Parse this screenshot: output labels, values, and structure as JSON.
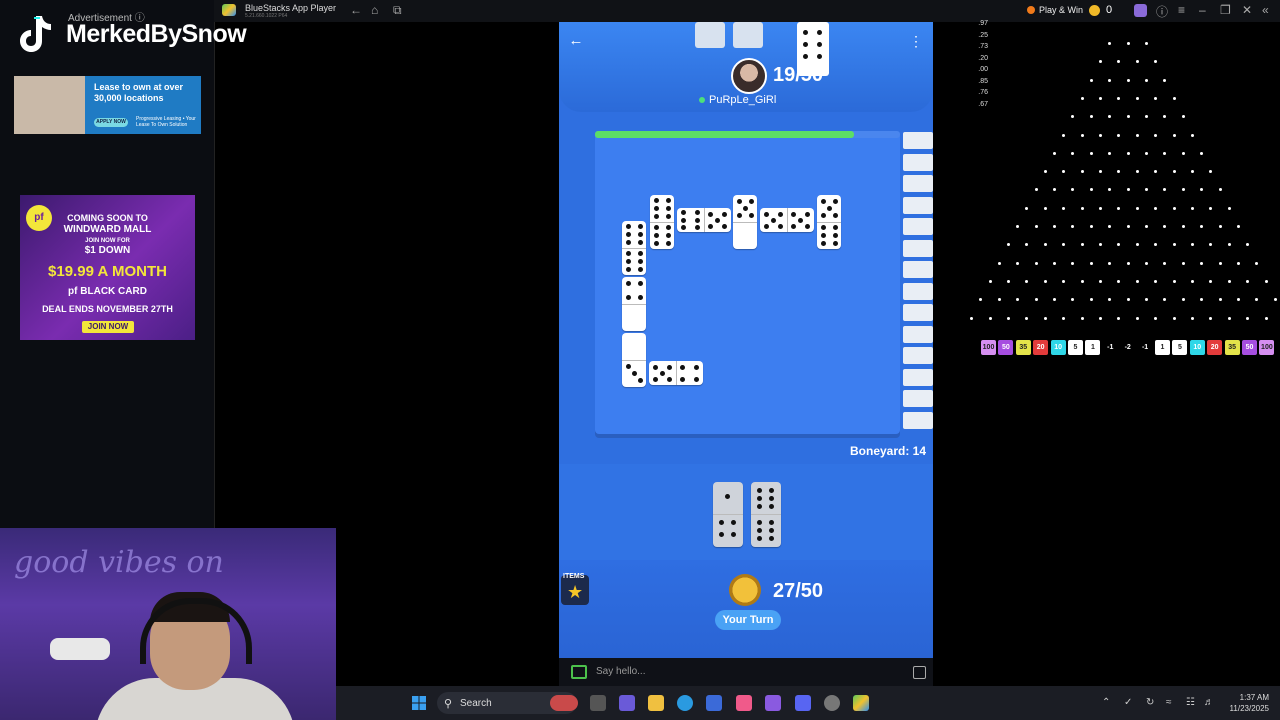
{
  "overlay": {
    "advertisement_label": "Advertisement ⓘ",
    "streamer_name": "MerkedBySnow",
    "ad1": {
      "headline": "Lease to own at over 30,000 locations",
      "button": "APPLY NOW",
      "sub": "Progressive Leasing • Your Lease To Own Solution"
    },
    "ad2": {
      "line1": "COMING SOON TO",
      "line2": "WINDWARD MALL",
      "line3": "JOIN NOW FOR",
      "line4": "$1 DOWN",
      "line5": "$19.99 A MONTH",
      "line6": "pf BLACK CARD",
      "line7": "DEAL ENDS NOVEMBER 27TH",
      "button": "JOIN NOW",
      "logo": "planet fitness"
    },
    "neon_text": "good vibes on"
  },
  "bluestacks": {
    "title": "BlueStacks App Player",
    "subtitle": "5.21.660.1022 P64",
    "play_win": "Play & Win",
    "coins": "0"
  },
  "game": {
    "opponent": {
      "name": "PuRpLe_GiRl",
      "score": "19/50"
    },
    "player": {
      "score": "27/50",
      "turn_label": "Your Turn"
    },
    "items_label": "ITEMS",
    "boneyard": "Boneyard: 14",
    "progress": 0.85,
    "chat_placeholder": "Say hello..."
  },
  "plinko": {
    "odds": [
      ".97",
      ".25",
      ".73",
      ".20",
      ".00",
      ".85",
      ".76",
      ".67"
    ],
    "buckets": [
      {
        "label": "100",
        "color": "#d58ef0"
      },
      {
        "label": "50",
        "color": "#a64ee0"
      },
      {
        "label": "35",
        "color": "#e3e34a"
      },
      {
        "label": "20",
        "color": "#e33b3b"
      },
      {
        "label": "10",
        "color": "#2fd7e8"
      },
      {
        "label": "5",
        "color": "#ffffff"
      },
      {
        "label": "1",
        "color": "#ffffff"
      },
      {
        "label": "-1",
        "color": "#000000"
      },
      {
        "label": "-2",
        "color": "#000000"
      },
      {
        "label": "-1",
        "color": "#000000"
      },
      {
        "label": "1",
        "color": "#ffffff"
      },
      {
        "label": "5",
        "color": "#ffffff"
      },
      {
        "label": "10",
        "color": "#2fd7e8"
      },
      {
        "label": "20",
        "color": "#e33b3b"
      },
      {
        "label": "35",
        "color": "#e3e34a"
      },
      {
        "label": "50",
        "color": "#a64ee0"
      },
      {
        "label": "100",
        "color": "#d58ef0"
      }
    ]
  },
  "taskbar": {
    "search_label": "Search",
    "time": "1:37 AM",
    "date": "11/23/2025"
  }
}
